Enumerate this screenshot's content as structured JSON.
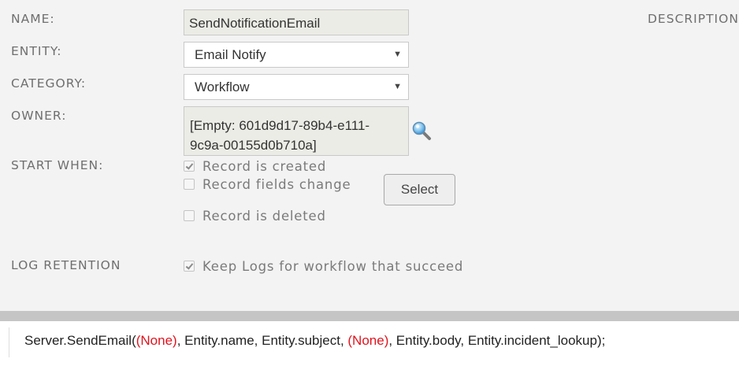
{
  "form": {
    "name_label": "NAME:",
    "name_value": "SendNotificationEmail",
    "description_label": "DESCRIPTION",
    "entity_label": "ENTITY:",
    "entity_value": "Email Notify",
    "category_label": "CATEGORY:",
    "category_value": "Workflow",
    "owner_label": "OWNER:",
    "owner_value_line1": "[Empty: 601d9d17-89b4-e111-",
    "owner_value_line2": "9c9a-00155d0b710a]",
    "lookup_icon": "magnifier-icon",
    "start_when_label": "START WHEN:",
    "start_options": [
      {
        "label": "Record is created",
        "checked": true
      },
      {
        "label": "Record fields change",
        "checked": false
      },
      {
        "label": "Record is deleted",
        "checked": false
      }
    ],
    "select_button_label": "Select",
    "log_retention_label": "LOG RETENTION",
    "log_option": {
      "label": "Keep Logs for workflow that succeed",
      "checked": true
    }
  },
  "dropdown_arrow": "▼",
  "code": {
    "prefix": "Server.SendEmail(",
    "token1": "(None)",
    "middle": ", Entity.name, Entity.subject, ",
    "token2": "(None)",
    "suffix": ", Entity.body, Entity.incident_lookup);"
  },
  "colors": {
    "form_background": "#f3f3f3",
    "splitter": "#c5c5c5",
    "none_token": "#e0141e"
  }
}
